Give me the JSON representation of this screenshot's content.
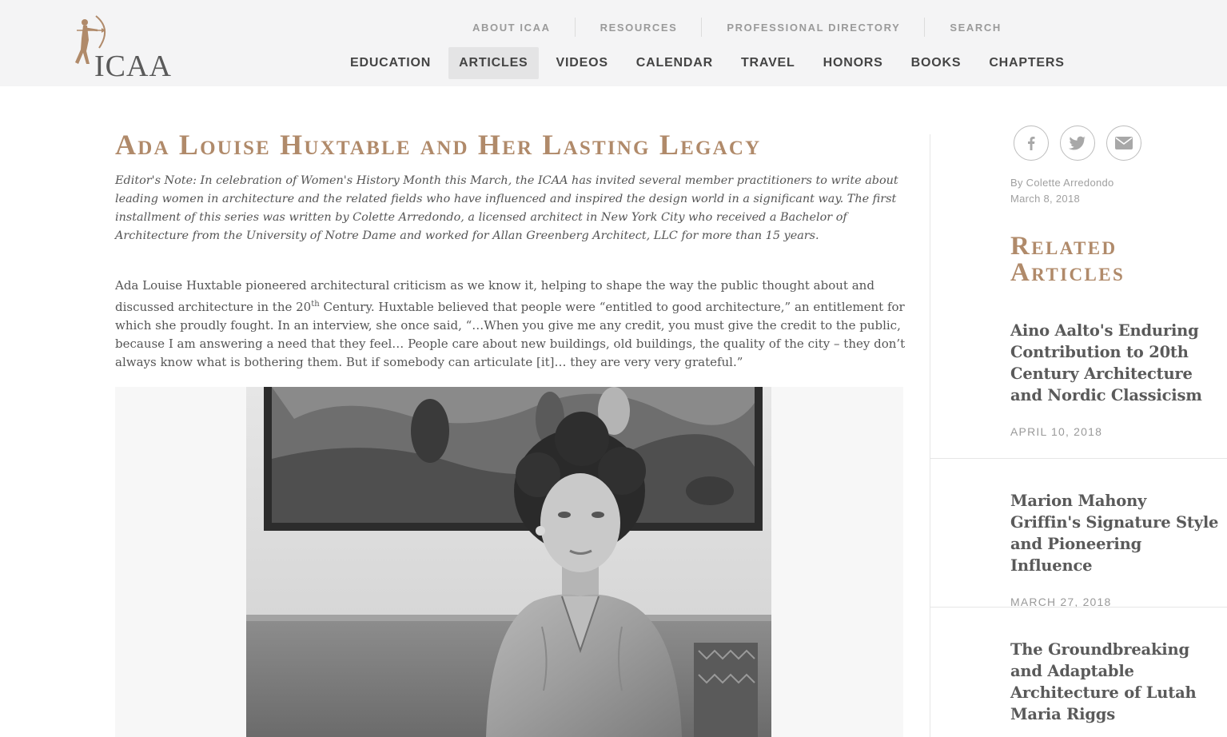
{
  "logo": {
    "text": "ICAA"
  },
  "top_nav": [
    {
      "label": "ABOUT ICAA"
    },
    {
      "label": "RESOURCES"
    },
    {
      "label": "PROFESSIONAL DIRECTORY"
    },
    {
      "label": "SEARCH"
    }
  ],
  "main_nav": [
    {
      "label": "EDUCATION"
    },
    {
      "label": "ARTICLES",
      "active": true
    },
    {
      "label": "VIDEOS"
    },
    {
      "label": "CALENDAR"
    },
    {
      "label": "TRAVEL"
    },
    {
      "label": "HONORS"
    },
    {
      "label": "BOOKS"
    },
    {
      "label": "CHAPTERS"
    }
  ],
  "article": {
    "title": "Ada Louise Huxtable and Her Lasting Legacy",
    "editor_note": "Editor's Note: In celebration of Women's History Month this March, the ICAA has invited several member practitioners to write about leading women in architecture and the related fields who have influenced and inspired the design world in a significant way. The first installment of this series was written by Colette Arredondo, a licensed architect in New York City who received a Bachelor of Architecture from the University of Notre Dame and worked for Allan Greenberg Architect, LLC for more than 15 years.",
    "body_before_sup": "Ada Louise Huxtable pioneered architectural criticism as we know it, helping to shape the way the public thought about and discussed architecture in the 20",
    "body_sup": "th",
    "body_after_sup": " Century. Huxtable believed that people were “entitled to good architecture,” an entitlement for which she proudly fought. In an interview, she once said, “…When you give me any credit, you must give the credit to the public, because I am answering a need that they feel… People care about new buildings, old buildings, the quality of the city – they don’t always know what is bothering them. But if somebody can articulate [it]… they are very very grateful.”"
  },
  "share": [
    {
      "icon": "facebook-icon"
    },
    {
      "icon": "twitter-icon"
    },
    {
      "icon": "email-icon"
    }
  ],
  "byline": {
    "author": "By Colette Arredondo",
    "date": "March 8, 2018"
  },
  "related": {
    "heading": "Related Articles",
    "items": [
      {
        "title": "Aino Aalto's Enduring Contribution to 20th Century Architecture and Nordic Classicism",
        "date": "APRIL 10, 2018"
      },
      {
        "title": "Marion Mahony Griffin's Signature Style and Pioneering Influence",
        "date": "MARCH 27, 2018"
      },
      {
        "title": "The Groundbreaking and Adaptable Architecture of Lutah Maria Riggs",
        "date": ""
      }
    ]
  },
  "colors": {
    "accent": "#b08a6a",
    "header_bg": "#f4f4f5",
    "nav_text": "#444444",
    "muted": "#9a9a9a"
  }
}
